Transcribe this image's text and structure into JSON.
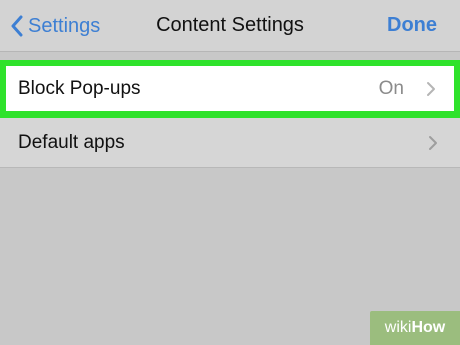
{
  "navbar": {
    "back_label": "Settings",
    "title": "Content Settings",
    "done_label": "Done"
  },
  "rows": [
    {
      "label": "Block Pop-ups",
      "value": "On"
    },
    {
      "label": "Default apps"
    }
  ],
  "watermark": {
    "prefix": "wiki",
    "suffix": "How"
  },
  "colors": {
    "accent": "#3d7fd3",
    "highlight": "#2fe22b",
    "background": "#c8c8c8"
  },
  "icons": {
    "back": "chevron-left-icon",
    "row": "chevron-right-icon"
  }
}
